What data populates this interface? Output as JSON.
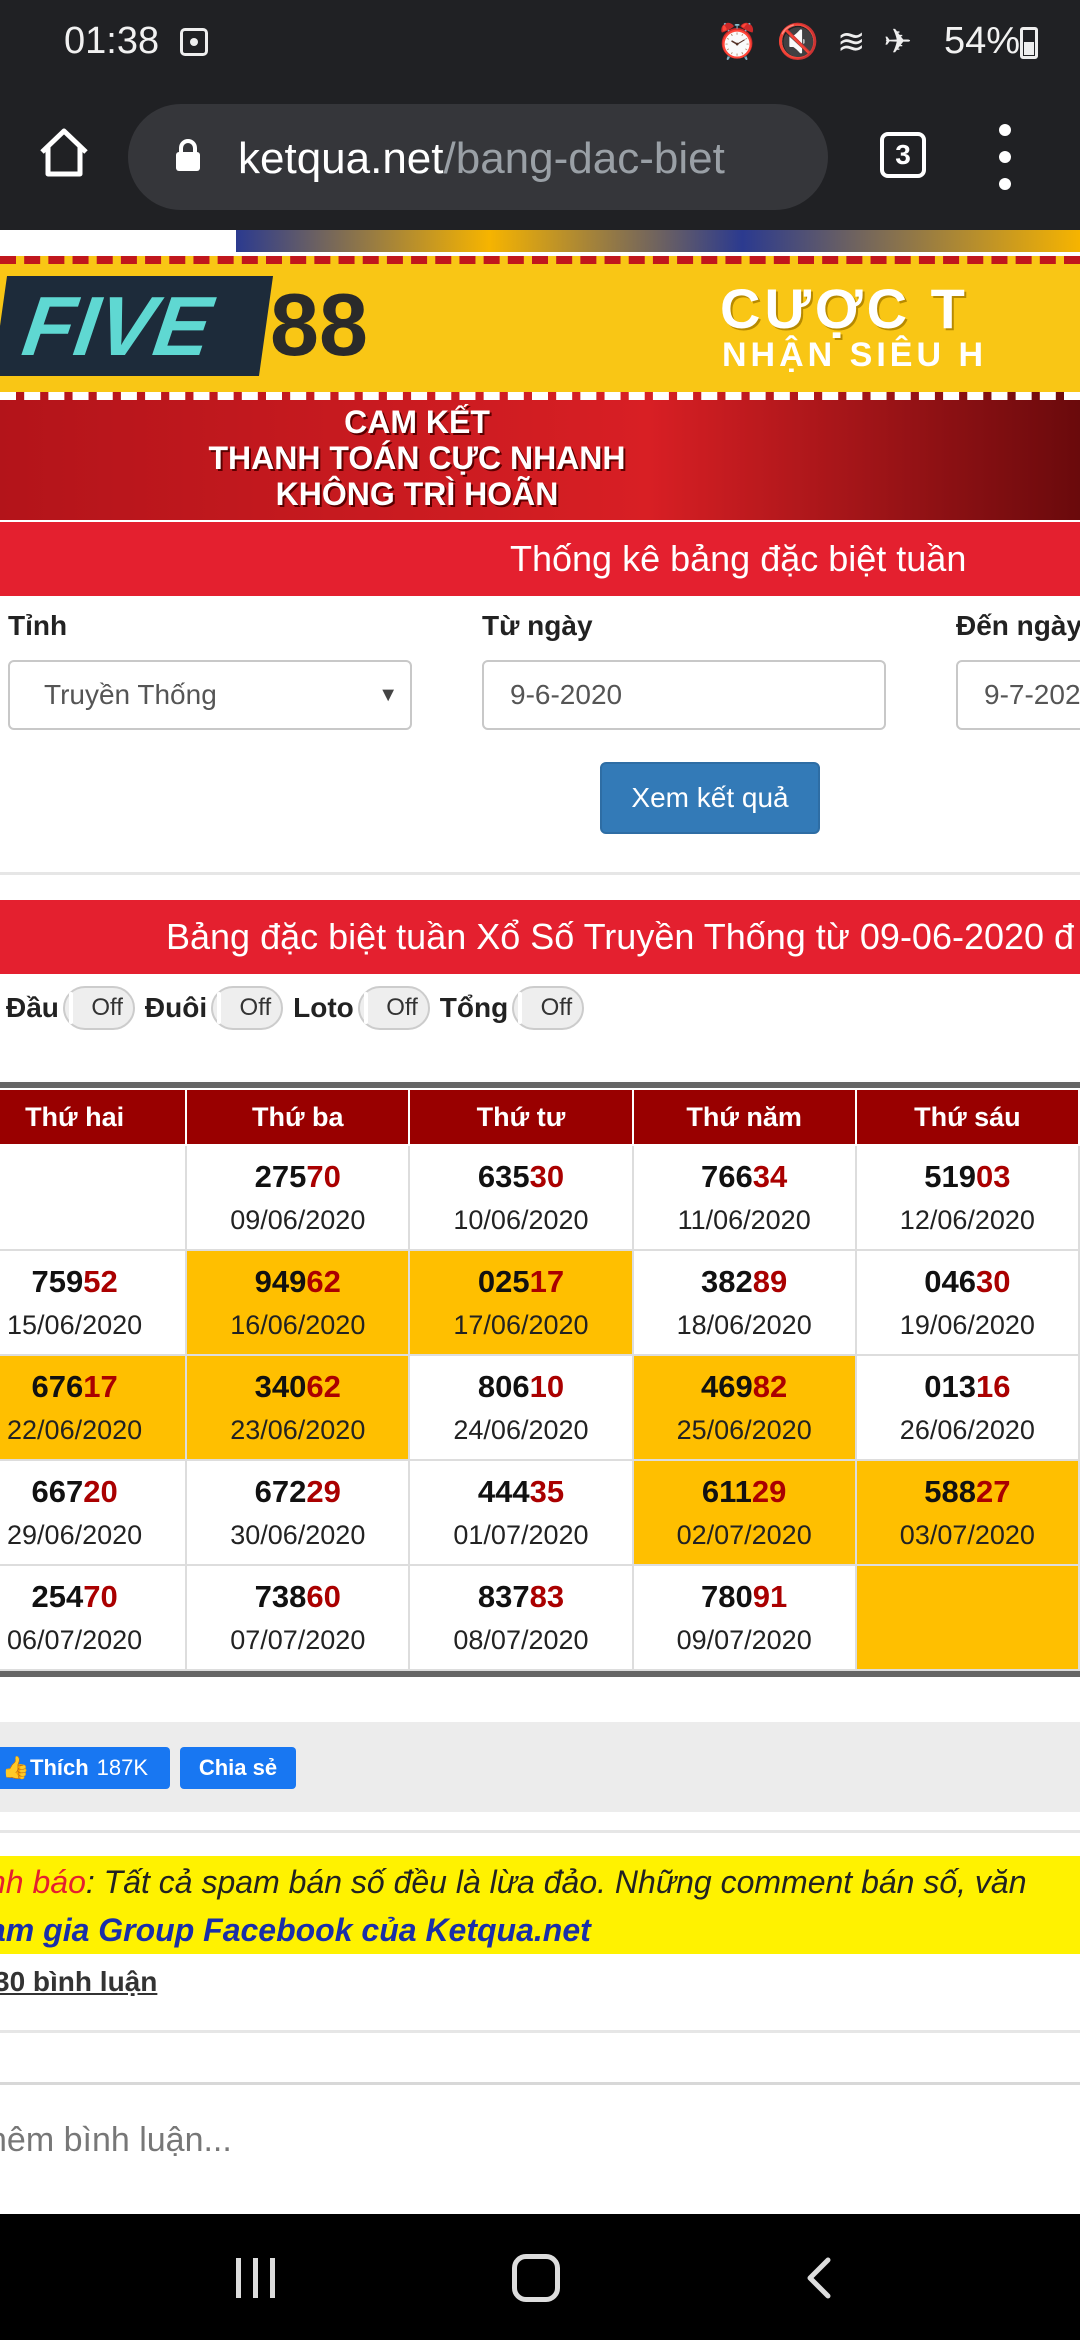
{
  "status": {
    "time": "01:38",
    "battery": "54%"
  },
  "browser": {
    "domain": "ketqua.net",
    "path": "/bang-dac-biet",
    "tab_count": "3"
  },
  "ad": {
    "brand_left": "FIVE",
    "brand_right": "88",
    "headline": "CƯỢC T",
    "subline": "NHẬN SIÊU H",
    "promise": [
      "CAM KẾT",
      "THANH TOÁN CỰC NHANH",
      "KHÔNG TRÌ HOÃN"
    ]
  },
  "form": {
    "title": "Thống kê bảng đặc biệt tuần",
    "province_label": "Tỉnh",
    "province_value": "Truyền Thống",
    "from_label": "Từ ngày",
    "from_value": "9-6-2020",
    "to_label": "Đến ngày",
    "to_value": "9-7-202",
    "submit_label": "Xem kết quả"
  },
  "results": {
    "title": "Bảng đặc biệt tuần Xổ Số Truyền Thống từ 09-06-2020 đ",
    "toggles": [
      {
        "label": "Đầu",
        "state": "Off"
      },
      {
        "label": "Đuôi",
        "state": "Off"
      },
      {
        "label": "Loto",
        "state": "Off"
      },
      {
        "label": "Tổng",
        "state": "Off"
      }
    ],
    "columns": [
      "Thứ hai",
      "Thứ ba",
      "Thứ tư",
      "Thứ năm",
      "Thứ sáu"
    ],
    "rows": [
      [
        {
          "head": "",
          "tail": "",
          "date": "",
          "hl": false
        },
        {
          "head": "275",
          "tail": "70",
          "date": "09/06/2020",
          "hl": false
        },
        {
          "head": "635",
          "tail": "30",
          "date": "10/06/2020",
          "hl": false
        },
        {
          "head": "766",
          "tail": "34",
          "date": "11/06/2020",
          "hl": false
        },
        {
          "head": "519",
          "tail": "03",
          "date": "12/06/2020",
          "hl": false
        }
      ],
      [
        {
          "head": "759",
          "tail": "52",
          "date": "15/06/2020",
          "hl": false
        },
        {
          "head": "949",
          "tail": "62",
          "date": "16/06/2020",
          "hl": true
        },
        {
          "head": "025",
          "tail": "17",
          "date": "17/06/2020",
          "hl": true
        },
        {
          "head": "382",
          "tail": "89",
          "date": "18/06/2020",
          "hl": false
        },
        {
          "head": "046",
          "tail": "30",
          "date": "19/06/2020",
          "hl": false
        }
      ],
      [
        {
          "head": "676",
          "tail": "17",
          "date": "22/06/2020",
          "hl": true
        },
        {
          "head": "340",
          "tail": "62",
          "date": "23/06/2020",
          "hl": true
        },
        {
          "head": "806",
          "tail": "10",
          "date": "24/06/2020",
          "hl": false
        },
        {
          "head": "469",
          "tail": "82",
          "date": "25/06/2020",
          "hl": true
        },
        {
          "head": "013",
          "tail": "16",
          "date": "26/06/2020",
          "hl": false
        }
      ],
      [
        {
          "head": "667",
          "tail": "20",
          "date": "29/06/2020",
          "hl": false
        },
        {
          "head": "672",
          "tail": "29",
          "date": "30/06/2020",
          "hl": false
        },
        {
          "head": "444",
          "tail": "35",
          "date": "01/07/2020",
          "hl": false
        },
        {
          "head": "611",
          "tail": "29",
          "date": "02/07/2020",
          "hl": true
        },
        {
          "head": "588",
          "tail": "27",
          "date": "03/07/2020",
          "hl": true
        }
      ],
      [
        {
          "head": "254",
          "tail": "70",
          "date": "06/07/2020",
          "hl": false
        },
        {
          "head": "738",
          "tail": "60",
          "date": "07/07/2020",
          "hl": false
        },
        {
          "head": "837",
          "tail": "83",
          "date": "08/07/2020",
          "hl": false
        },
        {
          "head": "780",
          "tail": "91",
          "date": "09/07/2020",
          "hl": false
        },
        {
          "head": "",
          "tail": "",
          "date": "",
          "hl": true
        }
      ]
    ]
  },
  "social": {
    "like_label": "Thích",
    "like_count": "187K",
    "share_label": "Chia sẻ"
  },
  "warning": {
    "prefix": "nh báo",
    "text": ": Tất cả spam bán số đều là lừa đảo. Những comment bán số, văn",
    "line2": "am gia Group Facebook của Ketqua.net"
  },
  "comments": {
    "count_label": "30 bình luận",
    "input_placeholder": "hêm bình luận..."
  },
  "colors": {
    "header_red": "#e4202f",
    "table_head": "#990000",
    "highlight": "#ffbf00",
    "button_blue": "#337ab7"
  }
}
